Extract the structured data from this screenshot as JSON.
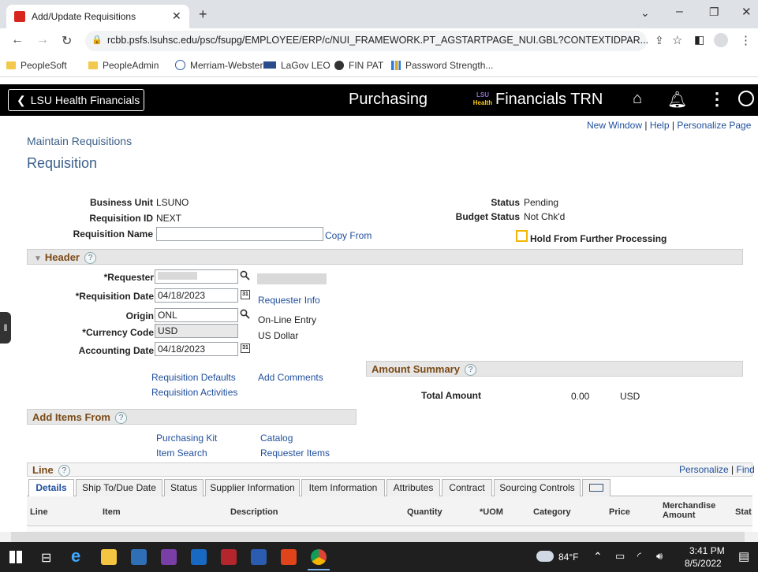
{
  "browser": {
    "tab_title": "Add/Update Requisitions",
    "url": "rcbb.psfs.lsuhsc.edu/psc/fsupg/EMPLOYEE/ERP/c/NUI_FRAMEWORK.PT_AGSTARTPAGE_NUI.GBL?CONTEXTIDPAR...",
    "bookmarks": [
      "PeopleSoft",
      "PeopleAdmin",
      "Merriam-Webster",
      "LaGov LEO",
      "FIN PAT",
      "Password Strength..."
    ]
  },
  "banner": {
    "back_label": "LSU Health Financials",
    "title": "Purchasing",
    "logo_top": "LSU",
    "logo_bottom": "Health",
    "brand": "Financials TRN"
  },
  "toplinks": {
    "new_window": "New Window",
    "help": "Help",
    "personalize": "Personalize Page"
  },
  "breadcrumb": "Maintain Requisitions",
  "page_title": "Requisition",
  "form": {
    "business_unit_label": "Business Unit",
    "business_unit": "LSUNO",
    "requisition_id_label": "Requisition ID",
    "requisition_id": "NEXT",
    "requisition_name_label": "Requisition Name",
    "copy_from": "Copy From",
    "status_label": "Status",
    "status": "Pending",
    "budget_status_label": "Budget Status",
    "budget_status": "Not Chk'd",
    "hold_label": "Hold From Further Processing"
  },
  "header": {
    "title": "Header",
    "requester_label": "*Requester",
    "req_date_label": "*Requisition Date",
    "req_date": "04/18/2023",
    "requester_info": "Requester Info",
    "origin_label": "Origin",
    "origin": "ONL",
    "origin_desc": "On-Line Entry",
    "currency_label": "*Currency Code",
    "currency": "USD",
    "currency_desc": "US Dollar",
    "acct_date_label": "Accounting Date",
    "acct_date": "04/18/2023",
    "req_defaults": "Requisition Defaults",
    "add_comments": "Add Comments",
    "req_activities": "Requisition Activities"
  },
  "amount_summary": {
    "title": "Amount Summary",
    "total_label": "Total Amount",
    "total": "0.00",
    "currency": "USD"
  },
  "add_items": {
    "title": "Add Items From",
    "purchasing_kit": "Purchasing Kit",
    "catalog": "Catalog",
    "item_search": "Item Search",
    "requester_items": "Requester Items"
  },
  "line": {
    "title": "Line",
    "personalize": "Personalize",
    "find": "Find",
    "tabs": [
      "Details",
      "Ship To/Due Date",
      "Status",
      "Supplier Information",
      "Item Information",
      "Attributes",
      "Contract",
      "Sourcing Controls"
    ],
    "columns": [
      "Line",
      "Item",
      "Description",
      "Quantity",
      "*UOM",
      "Category",
      "Price",
      "Merchandise Amount",
      "Stat"
    ]
  },
  "taskbar": {
    "temp": "84°F",
    "time": "3:41 PM",
    "date": "8/5/2022"
  }
}
